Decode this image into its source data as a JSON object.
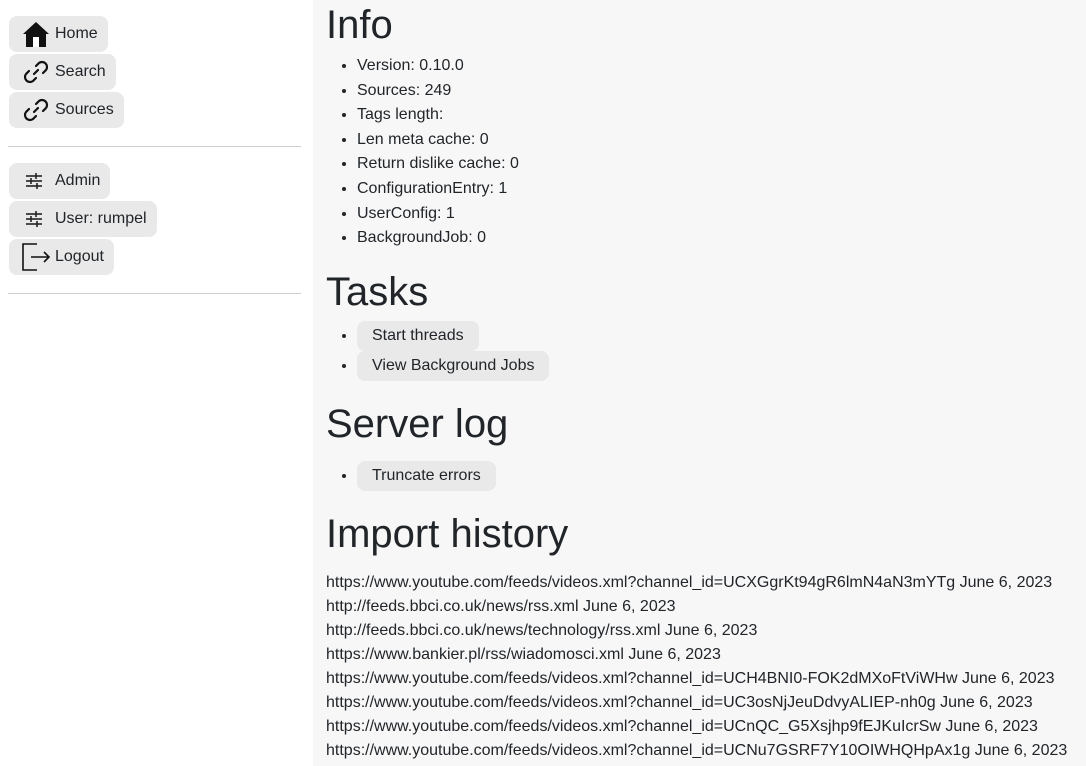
{
  "sidebar": {
    "primary": [
      {
        "label": "Home",
        "icon": "home-icon"
      },
      {
        "label": "Search",
        "icon": "link-icon"
      },
      {
        "label": "Sources",
        "icon": "link-icon"
      }
    ],
    "secondary": [
      {
        "label": "Admin",
        "icon": "sliders-icon"
      },
      {
        "label": "User: rumpel",
        "icon": "sliders-icon"
      },
      {
        "label": "Logout",
        "icon": "logout-icon"
      }
    ]
  },
  "info": {
    "title": "Info",
    "items": [
      "Version: 0.10.0",
      "Sources: 249",
      "Tags length:",
      "Len meta cache: 0",
      "Return dislike cache: 0",
      "ConfigurationEntry: 1",
      "UserConfig: 1",
      "BackgroundJob: 0"
    ]
  },
  "tasks": {
    "title": "Tasks",
    "buttons": [
      "Start threads",
      "View Background Jobs"
    ]
  },
  "server_log": {
    "title": "Server log",
    "buttons": [
      "Truncate errors"
    ]
  },
  "import_history": {
    "title": "Import history",
    "rows": [
      "https://www.youtube.com/feeds/videos.xml?channel_id=UCXGgrKt94gR6lmN4aN3mYTg June 6, 2023",
      "http://feeds.bbci.co.uk/news/rss.xml June 6, 2023",
      "http://feeds.bbci.co.uk/news/technology/rss.xml June 6, 2023",
      "https://www.bankier.pl/rss/wiadomosci.xml June 6, 2023",
      "https://www.youtube.com/feeds/videos.xml?channel_id=UCH4BNI0-FOK2dMXoFtViWHw June 6, 2023",
      "https://www.youtube.com/feeds/videos.xml?channel_id=UC3osNjJeuDdvyALIEP-nh0g June 6, 2023",
      "https://www.youtube.com/feeds/videos.xml?channel_id=UCnQC_G5Xsjhp9fEJKuIcrSw June 6, 2023",
      "https://www.youtube.com/feeds/videos.xml?channel_id=UCNu7GSRF7Y10OIWHQHpAx1g June 6, 2023"
    ]
  }
}
